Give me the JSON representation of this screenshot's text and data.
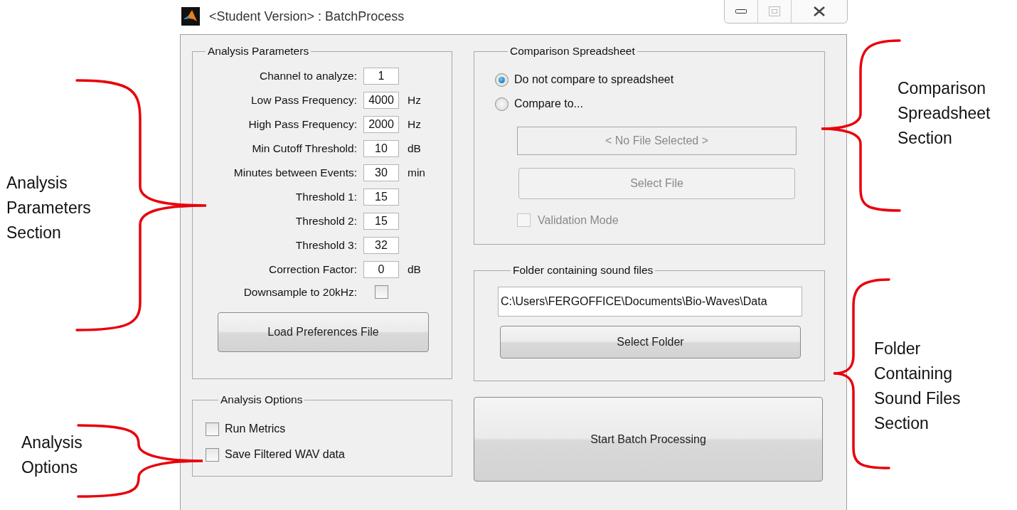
{
  "window": {
    "title": "<Student Version> : BatchProcess"
  },
  "analysis_parameters": {
    "title": "Analysis Parameters",
    "fields": [
      {
        "kind": "input",
        "label": "Channel to analyze:",
        "value": "1"
      },
      {
        "kind": "input",
        "label": "Low Pass Frequency:",
        "value": "4000",
        "unit": "Hz"
      },
      {
        "kind": "input",
        "label": "High Pass Frequency:",
        "value": "2000",
        "unit": "Hz"
      },
      {
        "kind": "input",
        "label": "Min Cutoff Threshold:",
        "value": "10",
        "unit": "dB"
      },
      {
        "kind": "input",
        "label": "Minutes between Events:",
        "value": "30",
        "unit": "min"
      },
      {
        "kind": "input",
        "label": "Threshold 1:",
        "value": "15"
      },
      {
        "kind": "input",
        "label": "Threshold 2:",
        "value": "15"
      },
      {
        "kind": "input",
        "label": "Threshold 3:",
        "value": "32"
      },
      {
        "kind": "input",
        "label": "Correction Factor:",
        "value": "0",
        "unit": "dB"
      },
      {
        "kind": "checkbox",
        "label": "Downsample to 20kHz:",
        "checked": false
      }
    ],
    "load_button": "Load Preferences File"
  },
  "analysis_options": {
    "title": "Analysis Options",
    "options": [
      {
        "label": "Run Metrics",
        "checked": false
      },
      {
        "label": "Save Filtered WAV data",
        "checked": false
      }
    ]
  },
  "comparison_spreadsheet": {
    "title": "Comparison Spreadsheet",
    "choices": [
      {
        "label": "Do not compare to spreadsheet",
        "selected": true
      },
      {
        "label": "Compare to...",
        "selected": false
      }
    ],
    "file_field": {
      "value": "< No File Selected >",
      "disabled": true
    },
    "select_file_button": {
      "label": "Select File",
      "disabled": true
    },
    "validation_mode": {
      "label": "Validation Mode",
      "checked": false,
      "disabled": true
    }
  },
  "folder": {
    "title": "Folder containing sound files",
    "path": "C:\\Users\\FERGOFFICE\\Documents\\Bio-Waves\\Data",
    "select_button": "Select Folder"
  },
  "start_button": "Start Batch Processing",
  "annotations": [
    {
      "text": "Analysis\nParameters\nSection"
    },
    {
      "text": "Analysis\nOptions"
    },
    {
      "text": "Comparison\nSpreadsheet\nSection"
    },
    {
      "text": "Folder\nContaining\nSound Files\nSection"
    }
  ]
}
